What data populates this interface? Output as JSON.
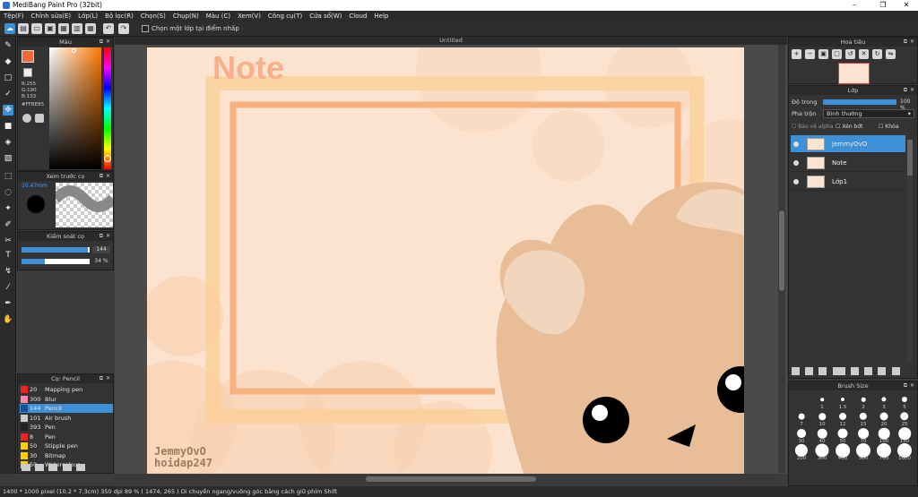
{
  "window": {
    "title": "MediBang Paint Pro (32bit)",
    "min": "–",
    "max": "❐",
    "close": "✕"
  },
  "menu": [
    "Tệp(F)",
    "Chỉnh sửa(E)",
    "Lớp(L)",
    "Bộ lọc(R)",
    "Chọn(S)",
    "Chụp(N)",
    "Màu (C)",
    "Xem(V)",
    "Công cụ(T)",
    "Cửa sổ(W)",
    "Cloud",
    "Help"
  ],
  "toolbar": {
    "select_label": "Chọn một lớp tại điểm nhấp"
  },
  "color_panel": {
    "title": "Màu",
    "r": "R:255",
    "g": "G:190",
    "b": "B:133",
    "hex": "#FFBE85"
  },
  "brush_preview": {
    "title": "Xem trước cọ",
    "size": "10.47mm"
  },
  "brush_control": {
    "title": "Kiểm soát cọ",
    "size": "144",
    "opacity": "34 %",
    "size_frac": 0.97,
    "opacity_frac": 0.34
  },
  "brush_list": {
    "title": "Cọ: Pencil",
    "items": [
      {
        "size": "20",
        "name": "Mapping pen",
        "color": "#ee2222"
      },
      {
        "size": "300",
        "name": "Blur",
        "color": "#ff88aa"
      },
      {
        "size": "144",
        "name": "Pencil",
        "color": "#1b4f9a"
      },
      {
        "size": "101",
        "name": "Air brush",
        "color": "#cccccc"
      },
      {
        "size": "393",
        "name": "Pen",
        "color": "#222222"
      },
      {
        "size": "8",
        "name": "Pen",
        "color": "#ee2222"
      },
      {
        "size": "50",
        "name": "Stipple pen",
        "color": "#ffcc00"
      },
      {
        "size": "30",
        "name": "Bitmap",
        "color": "#ffcc00"
      },
      {
        "size": "50",
        "name": "Watercolour",
        "color": "#ffcc00"
      }
    ]
  },
  "document": {
    "tab": "Untitled",
    "heading": "Note",
    "signature_line1": "JemmyOvO",
    "signature_line2": "hoidap247"
  },
  "navigator": {
    "title": "Hoa tiêu"
  },
  "layers": {
    "title": "Lớp",
    "opacity_label": "Độ trong",
    "opacity_value": "100 %",
    "blend_label": "Pha trộn",
    "blend_value": "Bình thường",
    "protect_alpha": "Bảo vệ alpha",
    "clipping": "Xén bớt",
    "lock": "Khóa",
    "items": [
      {
        "name": "JemmyOvO",
        "selected": true
      },
      {
        "name": "Note",
        "selected": false
      },
      {
        "name": "Lớp1",
        "selected": false
      }
    ]
  },
  "brush_size": {
    "title": "Brush Size",
    "values": [
      "1",
      "1.5",
      "2",
      "3",
      "5",
      "7",
      "10",
      "12",
      "15",
      "20",
      "25",
      "30",
      "40",
      "50",
      "70",
      "100",
      "150",
      "200",
      "300",
      "400",
      "500",
      "700",
      "1000"
    ]
  },
  "status": "1400 * 1000 pixel   (10.2 * 7.3cm)   350 dpi   89 %   ( 1474, 265 )   Di chuyển ngang/vuông góc bằng cách giữ phím Shift"
}
